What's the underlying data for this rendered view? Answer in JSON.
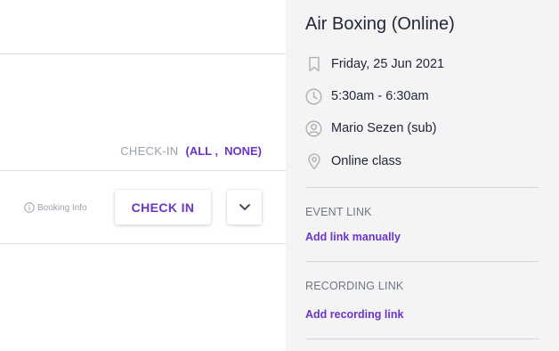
{
  "colors": {
    "accent": "#6a35c9",
    "muted_text": "#9aa1ab",
    "panel_background": "#f4f4f4"
  },
  "main": {
    "checkin_controls": {
      "label": "CHECK-IN",
      "open_paren": "(",
      "all_label": "ALL ,",
      "none_label": "NONE",
      "close_paren": ")"
    },
    "booking_row": {
      "booking_info_label": "Booking Info",
      "booking_info_icon": "info-icon",
      "checkin_button_label": "CHECK IN",
      "dropdown_icon": "chevron-down-icon"
    }
  },
  "details": {
    "title": "Air Boxing (Online)",
    "rows": [
      {
        "icon": "bookmark-icon",
        "text": "Friday, 25 Jun 2021"
      },
      {
        "icon": "clock-icon",
        "text": "5:30am - 6:30am"
      },
      {
        "icon": "user-icon",
        "text": "Mario Sezen (sub)"
      },
      {
        "icon": "location-pin-icon",
        "text": "Online class"
      }
    ],
    "event_link": {
      "heading": "EVENT LINK",
      "action_label": "Add link manually"
    },
    "recording_link": {
      "heading": "RECORDING LINK",
      "action_label": "Add recording link"
    }
  }
}
